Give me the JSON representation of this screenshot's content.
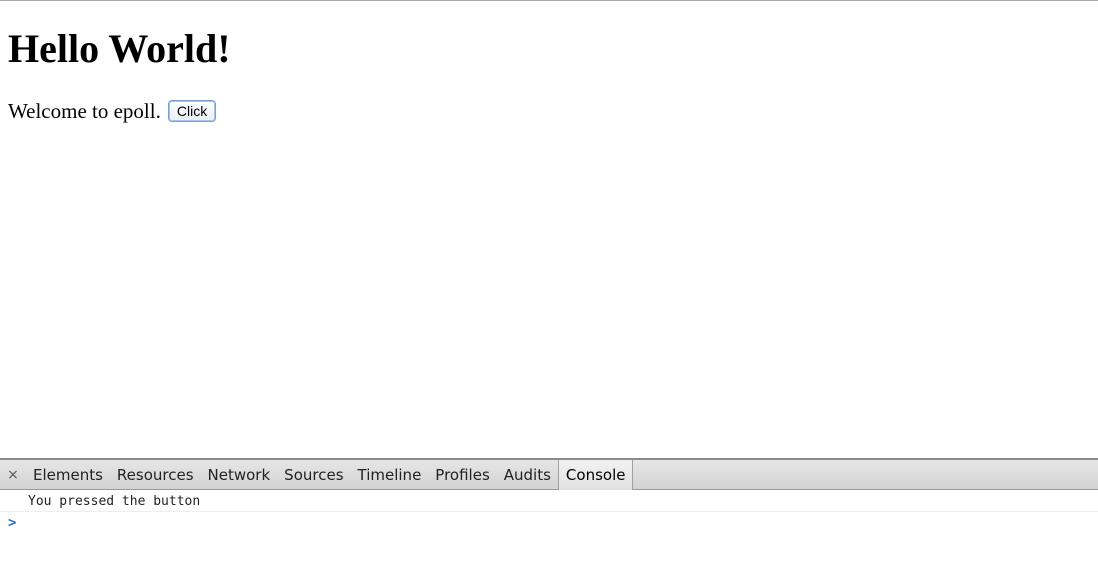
{
  "page": {
    "heading": "Hello World!",
    "welcome_text": "Welcome to epoll.",
    "button_label": "Click"
  },
  "devtools": {
    "close_glyph": "×",
    "tabs": [
      {
        "label": "Elements",
        "selected": false
      },
      {
        "label": "Resources",
        "selected": false
      },
      {
        "label": "Network",
        "selected": false
      },
      {
        "label": "Sources",
        "selected": false
      },
      {
        "label": "Timeline",
        "selected": false
      },
      {
        "label": "Profiles",
        "selected": false
      },
      {
        "label": "Audits",
        "selected": false
      },
      {
        "label": "Console",
        "selected": true
      }
    ],
    "console": {
      "messages": [
        "You pressed the button"
      ],
      "prompt_glyph": ">"
    }
  },
  "colors": {
    "prompt": "#2a6fd6"
  },
  "icons": {
    "close": "close-icon",
    "prompt": "chevron-right-icon"
  }
}
